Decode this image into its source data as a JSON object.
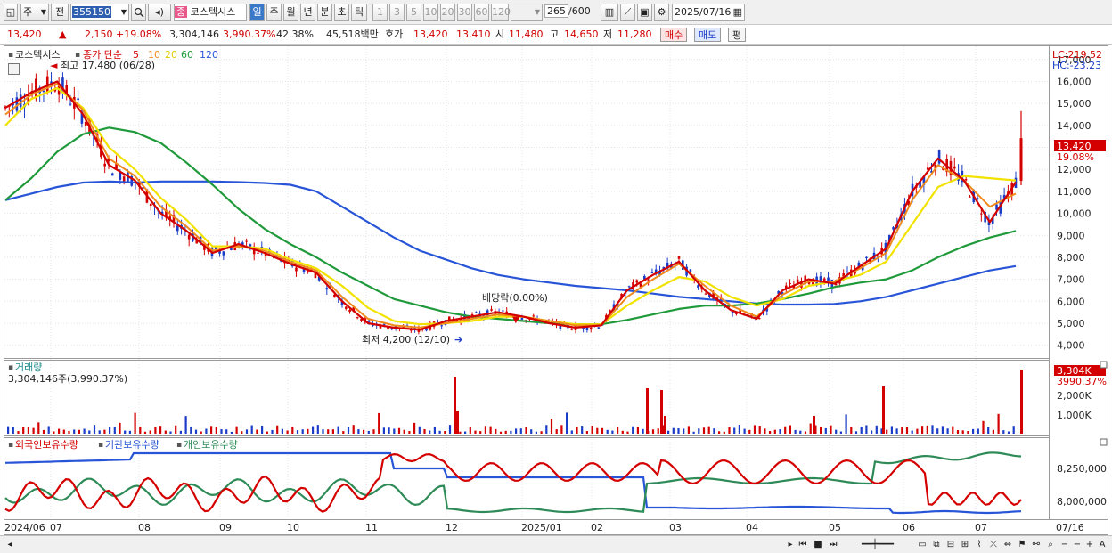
{
  "toolbar": {
    "type1": "주",
    "type2": "전",
    "code": "355150",
    "jong_label": "종",
    "stock_name": "코스텍시스",
    "periods": [
      "일",
      "주",
      "월",
      "년",
      "분",
      "초",
      "틱"
    ],
    "active_period": "일",
    "intervals": [
      "1",
      "3",
      "5",
      "10",
      "20",
      "30",
      "60",
      "120"
    ],
    "count": "265",
    "count_max": "/600",
    "date": "2025/07/16"
  },
  "quote": {
    "price": "13,420",
    "change_arrow": "▲",
    "change": "2,150",
    "change_pct": "+19.08%",
    "volume": "3,304,146",
    "volume_pct": "3,990.37%",
    "turnover": "42.38%",
    "amount": "45,518백만",
    "ask_label": "호가",
    "ask": "13,420",
    "bid": "13,410",
    "open_label": "시",
    "open": "11,480",
    "high_label": "고",
    "high": "14,650",
    "low_label": "저",
    "low": "11,280",
    "buy_label": "매수",
    "sell_label": "매도",
    "eval_label": "평"
  },
  "legend": {
    "name": "코스텍시스",
    "ma_label": "종가 단순",
    "ma_periods": [
      "5",
      "10",
      "20",
      "60",
      "120"
    ],
    "ma_colors": [
      "#d40000",
      "#f08a1c",
      "#f2e200",
      "#1f9a3a",
      "#2855d8"
    ],
    "lc": "LC:219.52",
    "hc": "HC:-23.23"
  },
  "annotations": {
    "high": "최고 17,480 (06/28)",
    "low": "최저 4,200 (12/10)",
    "dividend": "배당락(0.00%)",
    "last_price": "13,420",
    "last_pct": "19.08%"
  },
  "volume_panel": {
    "title": "거래량",
    "value": "3,304,146주(3,990.37%)",
    "badge": "3,304K",
    "badge_pct": "3990.37%",
    "ticks": [
      "2,000K",
      "1,000K"
    ]
  },
  "holdings_panel": {
    "labels": [
      "외국인보유수량",
      "기관보유수량",
      "개인보유수량"
    ],
    "colors": [
      "#d40000",
      "#2855d8",
      "#2e8b57"
    ],
    "ticks": [
      "8,250,000",
      "8,000,000"
    ]
  },
  "chart_data": {
    "type": "candlestick",
    "title": "코스텍시스",
    "price_axis": {
      "ticks": [
        "17,000",
        "16,000",
        "15,000",
        "14,000",
        "13,000",
        "12,000",
        "11,000",
        "10,000",
        "9,000",
        "8,000",
        "7,000",
        "6,000",
        "5,000",
        "4,000"
      ],
      "range": [
        3500,
        17600
      ]
    },
    "x_axis": {
      "labels": [
        "2024/06",
        "07",
        "08",
        "09",
        "10",
        "11",
        "12",
        "2025/01",
        "02",
        "03",
        "04",
        "05",
        "06",
        "07",
        "07/16"
      ]
    },
    "ma": {
      "ma5": [
        14800,
        15500,
        16000,
        14500,
        12200,
        11500,
        10000,
        9200,
        8200,
        8600,
        8200,
        7700,
        7300,
        6000,
        5000,
        4800,
        4700,
        5100,
        5300,
        5500,
        5300,
        5000,
        4800,
        4900,
        6500,
        7200,
        7800,
        6500,
        5600,
        5200,
        6500,
        7000,
        6800,
        7600,
        8400,
        11000,
        12500,
        11500,
        9600,
        11420
      ],
      "ma10": [
        14500,
        15400,
        15900,
        14700,
        12500,
        11700,
        10300,
        9400,
        8300,
        8500,
        8300,
        7800,
        7400,
        6200,
        5200,
        4900,
        4800,
        5000,
        5200,
        5400,
        5300,
        5100,
        4900,
        4900,
        6200,
        7000,
        7700,
        6700,
        5800,
        5300,
        6300,
        6900,
        6900,
        7500,
        8200,
        10600,
        12200,
        11500,
        10300,
        10900
      ],
      "ma20": [
        14000,
        15200,
        15700,
        14800,
        13000,
        12000,
        10700,
        9700,
        8500,
        8500,
        8400,
        7900,
        7500,
        6700,
        5700,
        5100,
        4950,
        5000,
        5100,
        5300,
        5300,
        5100,
        4950,
        4950,
        5800,
        6500,
        7100,
        6900,
        6200,
        5800,
        6100,
        6700,
        6900,
        7200,
        7800,
        9500,
        11200,
        11700,
        11600,
        11500
      ],
      "ma60": [
        10600,
        11600,
        12800,
        13600,
        13900,
        13700,
        13200,
        12300,
        11300,
        10200,
        9300,
        8600,
        8000,
        7300,
        6700,
        6100,
        5800,
        5500,
        5300,
        5200,
        5100,
        5000,
        4950,
        4950,
        5150,
        5400,
        5650,
        5800,
        5800,
        5900,
        6100,
        6350,
        6650,
        6850,
        7000,
        7400,
        8000,
        8500,
        8900,
        9200
      ],
      "ma120": [
        10600,
        10900,
        11200,
        11400,
        11450,
        11400,
        11450,
        11450,
        11450,
        11420,
        11380,
        11300,
        11000,
        10300,
        9600,
        8900,
        8300,
        7900,
        7500,
        7200,
        7000,
        6850,
        6700,
        6600,
        6500,
        6350,
        6200,
        6100,
        6000,
        5900,
        5850,
        5850,
        5880,
        6000,
        6200,
        6500,
        6800,
        7100,
        7400,
        7600
      ]
    }
  }
}
